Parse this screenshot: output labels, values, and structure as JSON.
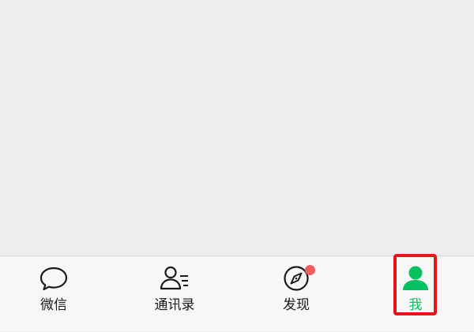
{
  "tabs": [
    {
      "id": "chats",
      "label": "微信",
      "icon": "chat-bubble-icon",
      "active": false
    },
    {
      "id": "contacts",
      "label": "通讯录",
      "icon": "contacts-icon",
      "active": false
    },
    {
      "id": "discover",
      "label": "发现",
      "icon": "compass-icon",
      "active": false,
      "badge": "dot"
    },
    {
      "id": "me",
      "label": "我",
      "icon": "person-icon",
      "active": true
    }
  ],
  "colors": {
    "active": "#07c160",
    "inactive": "#1a1a1a",
    "badge": "#f25e5e",
    "highlight": "#e8141c",
    "background": "#ededed",
    "tab_bar": "#f7f7f7"
  }
}
